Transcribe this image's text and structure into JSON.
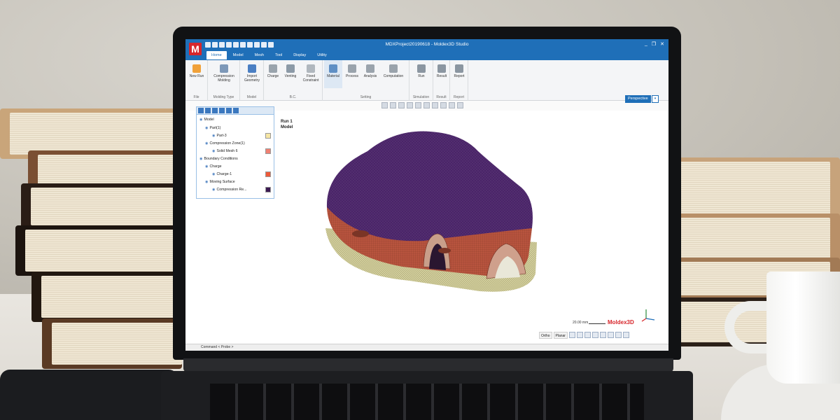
{
  "window": {
    "title": "MDXProject20190618 - Moldex3D Studio",
    "controls": [
      "_",
      "❐",
      "✕"
    ],
    "logo_letter": "M"
  },
  "tabs": [
    "Home",
    "Model",
    "Mesh",
    "Tool",
    "Display",
    "Utility"
  ],
  "ribbon": {
    "new_run": "New Run",
    "file_group": "File",
    "compression_molding": "Compression Molding",
    "molding_type_group": "Molding Type",
    "import_geometry": "Import Geometry",
    "model_group": "Model",
    "charge": "Charge",
    "venting": "Venting",
    "fixed_constraint": "Fixed Constraint",
    "bc_group": "B.C.",
    "material": "Material",
    "process": "Process",
    "analysis": "Analysis",
    "computation": "Computation",
    "setting_group": "Setting",
    "run": "Run",
    "simulation_group": "Simulation",
    "result": "Result",
    "result_group": "Result",
    "report": "Report",
    "report_group": "Report"
  },
  "view": {
    "perspective": "Perspective",
    "run_label": "Run 1",
    "model_label": "Model"
  },
  "tree": [
    {
      "label": "Model",
      "indent": 0
    },
    {
      "label": "Part(1)",
      "indent": 1
    },
    {
      "label": "Part-3",
      "indent": 2,
      "color": "#f6e6a4"
    },
    {
      "label": "Compression Zone(1)",
      "indent": 1
    },
    {
      "label": "Solid Mesh 6",
      "indent": 2,
      "color": "#f08072"
    },
    {
      "label": "Boundary Conditions",
      "indent": 0
    },
    {
      "label": "Charge",
      "indent": 1
    },
    {
      "label": "Charge-1",
      "indent": 2,
      "color": "#ee5a3a"
    },
    {
      "label": "Moving Surface",
      "indent": 1
    },
    {
      "label": "Compression Re...",
      "indent": 2,
      "color": "#3c1a52"
    }
  ],
  "scale": {
    "value": "20.00 mm",
    "brand": "Moldex3D"
  },
  "viewbar": {
    "ortho": "Ortho",
    "planar": "Planar"
  },
  "status": {
    "text": "Command < Probe >"
  },
  "colors": {
    "accent": "#1f6fb8",
    "brand_red": "#d7262b",
    "mold_top": "#4a2468",
    "mold_side": "#b8543e",
    "mesh_base": "#d6d2a0"
  }
}
